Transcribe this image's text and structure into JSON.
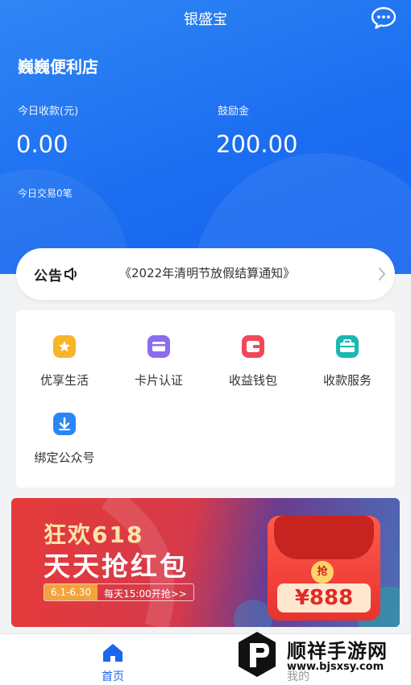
{
  "header": {
    "app_title": "银盛宝",
    "store_name": "巍巍便利店",
    "today_income_label": "今日收款(元)",
    "today_income_value": "0.00",
    "bonus_label": "鼓励金",
    "bonus_value": "200.00",
    "today_trades": "今日交易0笔"
  },
  "notice": {
    "badge": "公告",
    "text": "《2022年清明节放假结算通知》"
  },
  "services": [
    {
      "label": "优享生活",
      "icon": "star-icon",
      "color": "#f7b52c"
    },
    {
      "label": "卡片认证",
      "icon": "card-icon",
      "color": "#8b6cf0"
    },
    {
      "label": "收益钱包",
      "icon": "wallet-icon",
      "color": "#f0485a"
    },
    {
      "label": "收款服务",
      "icon": "briefcase-icon",
      "color": "#19b9b0"
    },
    {
      "label": "绑定公众号",
      "icon": "download-icon",
      "color": "#2a86f4"
    }
  ],
  "banner": {
    "title1": "狂欢618",
    "title2": "天天抢红包",
    "date_range": "6.1-6.30",
    "time_text": "每天15:00开抢>>",
    "coin": "抢",
    "amount": "¥888"
  },
  "tabbar": {
    "home": "首页",
    "mine": "我的"
  },
  "watermark": {
    "name": "顺祥手游网",
    "url": "www.bjsxsy.com"
  },
  "colors": {
    "primary": "#1a6cf0",
    "tab_active": "#1a66ee"
  }
}
